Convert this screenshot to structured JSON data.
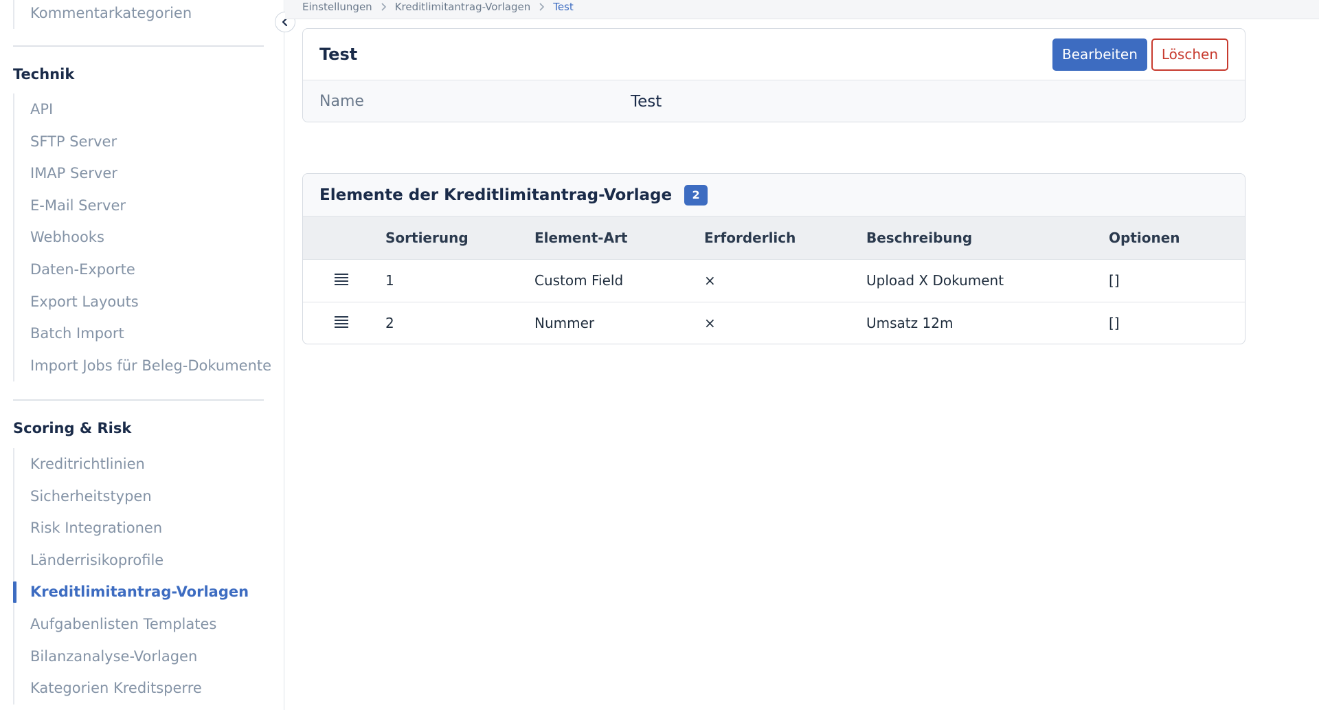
{
  "sidebar": {
    "top_item": "Kommentarkategorien",
    "groups": [
      {
        "title": "Technik",
        "items": [
          "API",
          "SFTP Server",
          "IMAP Server",
          "E-Mail Server",
          "Webhooks",
          "Daten-Exporte",
          "Export Layouts",
          "Batch Import",
          "Import Jobs für Beleg-Dokumente"
        ]
      },
      {
        "title": "Scoring & Risk",
        "items": [
          "Kreditrichtlinien",
          "Sicherheitstypen",
          "Risk Integrationen",
          "Länderrisikoprofile",
          "Kreditlimitantrag-Vorlagen",
          "Aufgabenlisten Templates",
          "Bilanzanalyse-Vorlagen",
          "Kategorien Kreditsperre"
        ],
        "active_item": "Kreditlimitantrag-Vorlagen"
      }
    ]
  },
  "breadcrumb": [
    "Einstellungen",
    "Kreditlimitantrag-Vorlagen",
    "Test"
  ],
  "detail": {
    "title": "Test",
    "edit_label": "Bearbeiten",
    "delete_label": "Löschen",
    "name_label": "Name",
    "name_value": "Test"
  },
  "elements": {
    "title": "Elemente der Kreditlimitantrag-Vorlage",
    "count": "2",
    "columns": [
      "Sortierung",
      "Element-Art",
      "Erforderlich",
      "Beschreibung",
      "Optionen"
    ],
    "rows": [
      {
        "sort": "1",
        "type": "Custom Field",
        "required": "×",
        "description": "Upload X Dokument",
        "options": "[]"
      },
      {
        "sort": "2",
        "type": "Nummer",
        "required": "×",
        "description": "Umsatz 12m",
        "options": "[]"
      }
    ]
  },
  "colors": {
    "accent": "#3d6cc1",
    "danger": "#c73a2e"
  }
}
